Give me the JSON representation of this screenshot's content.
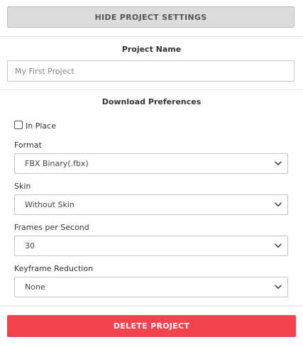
{
  "header": {
    "hide_settings_label": "HIDE PROJECT SETTINGS"
  },
  "project": {
    "name_heading": "Project Name",
    "name_value": "",
    "name_placeholder": "My First Project"
  },
  "download": {
    "heading": "Download Preferences",
    "in_place": {
      "label": "In Place",
      "checked": false
    },
    "format": {
      "label": "Format",
      "selected": "FBX Binary(.fbx)"
    },
    "skin": {
      "label": "Skin",
      "selected": "Without Skin"
    },
    "fps": {
      "label": "Frames per Second",
      "selected": "30"
    },
    "keyframe_reduction": {
      "label": "Keyframe Reduction",
      "selected": "None"
    }
  },
  "footer": {
    "delete_label": "DELETE PROJECT"
  },
  "colors": {
    "delete_button": "#f2434e",
    "hide_button": "#dcdcdc"
  },
  "icons": {
    "select_arrow": "chevron-down-icon"
  }
}
